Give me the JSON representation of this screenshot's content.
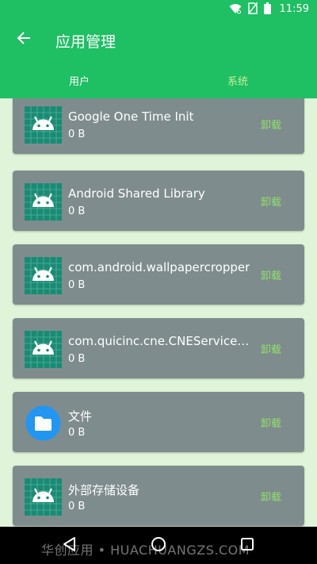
{
  "status_bar": {
    "time": "11:59"
  },
  "toolbar": {
    "title": "应用管理"
  },
  "tabs": [
    {
      "label": "用户"
    },
    {
      "label": "系统"
    }
  ],
  "apps": [
    {
      "name": "Google One Time Init",
      "size": "0 B",
      "action": "卸载",
      "icon": "android-robot-icon"
    },
    {
      "name": "Android Shared Library",
      "size": "0 B",
      "action": "卸载",
      "icon": "android-robot-icon"
    },
    {
      "name": "com.android.wallpapercropper",
      "size": "0 B",
      "action": "卸载",
      "icon": "android-robot-icon"
    },
    {
      "name": "com.quicinc.cne.CNEService.CN..",
      "size": "0 B",
      "action": "卸载",
      "icon": "android-robot-icon"
    },
    {
      "name": "文件",
      "size": "0 B",
      "action": "卸载",
      "icon": "files-folder-icon"
    },
    {
      "name": "外部存储设备",
      "size": "0 B",
      "action": "卸载",
      "icon": "android-robot-icon"
    }
  ],
  "watermark": "华创应用 • HUACHUANGZS.COM",
  "colors": {
    "primary": "#1fbf63",
    "card": "#7f8c8d",
    "background": "#dff4d9",
    "uninstall_text": "#8fe06a",
    "inactive_tab": "#c8ee9a"
  }
}
